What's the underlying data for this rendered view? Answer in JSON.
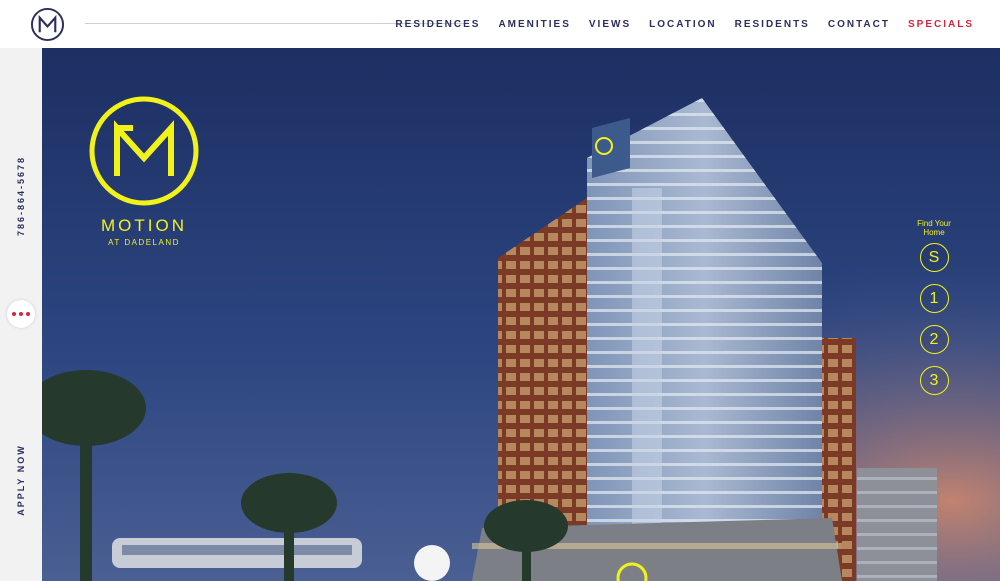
{
  "header": {
    "nav": [
      {
        "label": "RESIDENCES"
      },
      {
        "label": "AMENITIES"
      },
      {
        "label": "VIEWS"
      },
      {
        "label": "LOCATION"
      },
      {
        "label": "RESIDENTS"
      },
      {
        "label": "CONTACT"
      },
      {
        "label": "SPECIALS"
      }
    ]
  },
  "sidebar": {
    "phone": "786-864-5678",
    "apply": "APPLY NOW"
  },
  "hero": {
    "brand_name": "MOTION",
    "brand_sub": "AT DADELAND",
    "find_home_line1": "Find Your",
    "find_home_line2": "Home",
    "units": [
      "S",
      "1",
      "2",
      "3"
    ]
  },
  "colors": {
    "navy": "#2b2e5e",
    "accent_red": "#d6263d",
    "brand_yellow": "#f2f21b"
  }
}
